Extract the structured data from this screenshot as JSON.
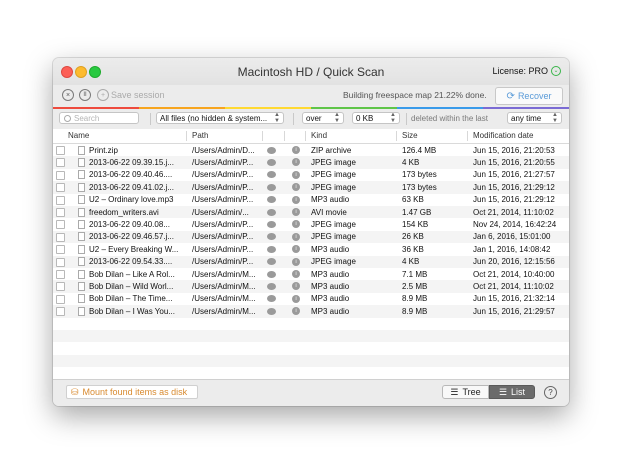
{
  "window": {
    "title": "Macintosh HD / Quick Scan",
    "license": "License: PRO"
  },
  "toolbar": {
    "stop_icon": "×",
    "pause_icon": "II",
    "add_icon": "+",
    "save_session": "Save session",
    "progress_text": "Building freespace map 21.22% done.",
    "recover_label": "Recover",
    "progress_colors": [
      "#ee4b3e",
      "#f7a51f",
      "#ffd932",
      "#5fc549",
      "#3a9bea",
      "#7b6bd4"
    ]
  },
  "filters": {
    "search_placeholder": "Search",
    "file_filter": "All files (no hidden & system...",
    "size_op": "over",
    "size_value": "0 KB",
    "deleted_label": "deleted within the last",
    "time_value": "any time"
  },
  "columns": {
    "name": "Name",
    "path": "Path",
    "kind": "Kind",
    "size": "Size",
    "modified": "Modification date"
  },
  "rows": [
    {
      "name": "Print.zip",
      "path": "/Users/Admin/D...",
      "kind": "ZIP archive",
      "size": "126.4 MB",
      "date": "Jun 15, 2016, 21:20:53"
    },
    {
      "name": "2013-06-22 09.39.15.j...",
      "path": "/Users/Admin/P...",
      "kind": "JPEG image",
      "size": "4 KB",
      "date": "Jun 15, 2016, 21:20:55"
    },
    {
      "name": "2013-06-22 09.40.46....",
      "path": "/Users/Admin/P...",
      "kind": "JPEG image",
      "size": "173 bytes",
      "date": "Jun 15, 2016, 21:27:57"
    },
    {
      "name": "2013-06-22 09.41.02.j...",
      "path": "/Users/Admin/P...",
      "kind": "JPEG image",
      "size": "173 bytes",
      "date": "Jun 15, 2016, 21:29:12"
    },
    {
      "name": "U2 – Ordinary love.mp3",
      "path": "/Users/Admin/P...",
      "kind": "MP3 audio",
      "size": "63 KB",
      "date": "Jun 15, 2016, 21:29:12"
    },
    {
      "name": "freedom_writers.avi",
      "path": "/Users/Admin/...",
      "kind": "AVI movie",
      "size": "1.47 GB",
      "date": "Oct 21, 2014, 11:10:02"
    },
    {
      "name": "2013-06-22 09.40.08...",
      "path": "/Users/Admin/P...",
      "kind": "JPEG image",
      "size": "154 KB",
      "date": "Nov 24, 2014, 16:42:24"
    },
    {
      "name": "2013-06-22 09.46.57.j...",
      "path": "/Users/Admin/P...",
      "kind": "JPEG image",
      "size": "26 KB",
      "date": "Jan 6, 2016, 15:01:00"
    },
    {
      "name": "U2 – Every Breaking W...",
      "path": "/Users/Admin/P...",
      "kind": "MP3 audio",
      "size": "36 KB",
      "date": "Jan 1, 2016, 14:08:42"
    },
    {
      "name": "2013-06-22 09.54.33....",
      "path": "/Users/Admin/P...",
      "kind": "JPEG image",
      "size": "4 KB",
      "date": "Jun 20, 2016, 12:15:56"
    },
    {
      "name": "Bob Dilan – Like A Rol...",
      "path": "/Users/Admin/M...",
      "kind": "MP3 audio",
      "size": "7.1 MB",
      "date": "Oct 21, 2014, 10:40:00"
    },
    {
      "name": "Bob Dilan – Wild Worl...",
      "path": "/Users/Admin/M...",
      "kind": "MP3 audio",
      "size": "2.5 MB",
      "date": "Oct 21, 2014, 11:10:02"
    },
    {
      "name": "Bob Dilan – The Time...",
      "path": "/Users/Admin/M...",
      "kind": "MP3 audio",
      "size": "8.9 MB",
      "date": "Jun 15, 2016, 21:32:14"
    },
    {
      "name": "Bob Dilan – I Was You...",
      "path": "/Users/Admin/M...",
      "kind": "MP3 audio",
      "size": "8.9 MB",
      "date": "Jun 15, 2016, 21:29:57"
    }
  ],
  "bottom": {
    "mount_label": "Mount found items as disk",
    "tree_label": "Tree",
    "list_label": "List",
    "help_label": "?"
  }
}
